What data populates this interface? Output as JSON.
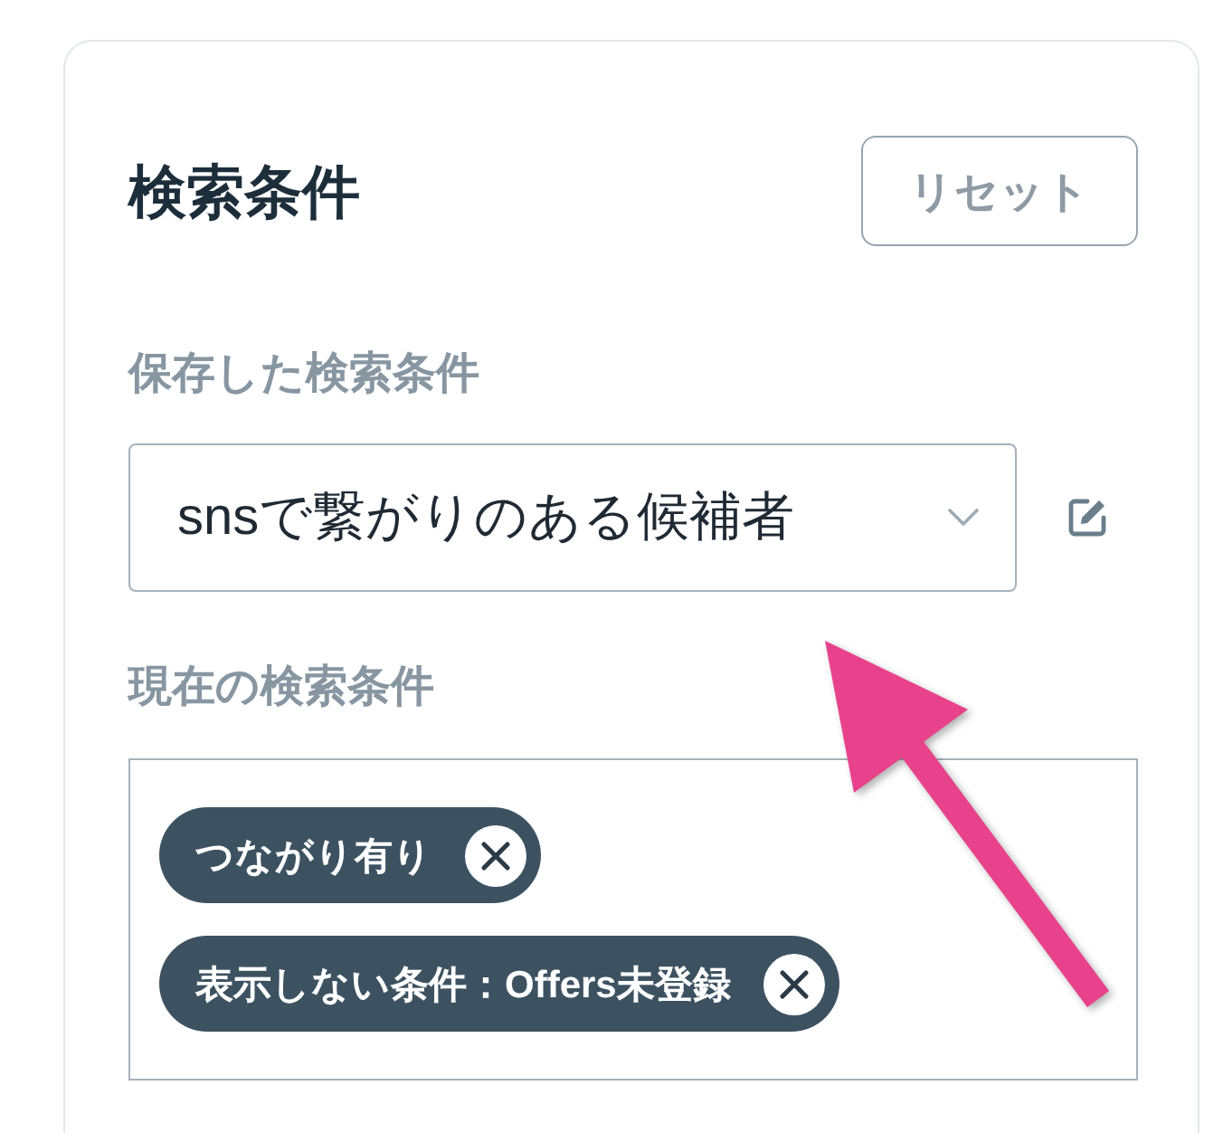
{
  "panel": {
    "title": "検索条件",
    "reset_button": "リセット"
  },
  "saved_search": {
    "label": "保存した検索条件",
    "value": "snsで繋がりのある候補者"
  },
  "current_conditions": {
    "label": "現在の検索条件",
    "chips": [
      {
        "label": "つながり有り"
      },
      {
        "label": "表示しない条件：Offers未登録"
      }
    ]
  }
}
